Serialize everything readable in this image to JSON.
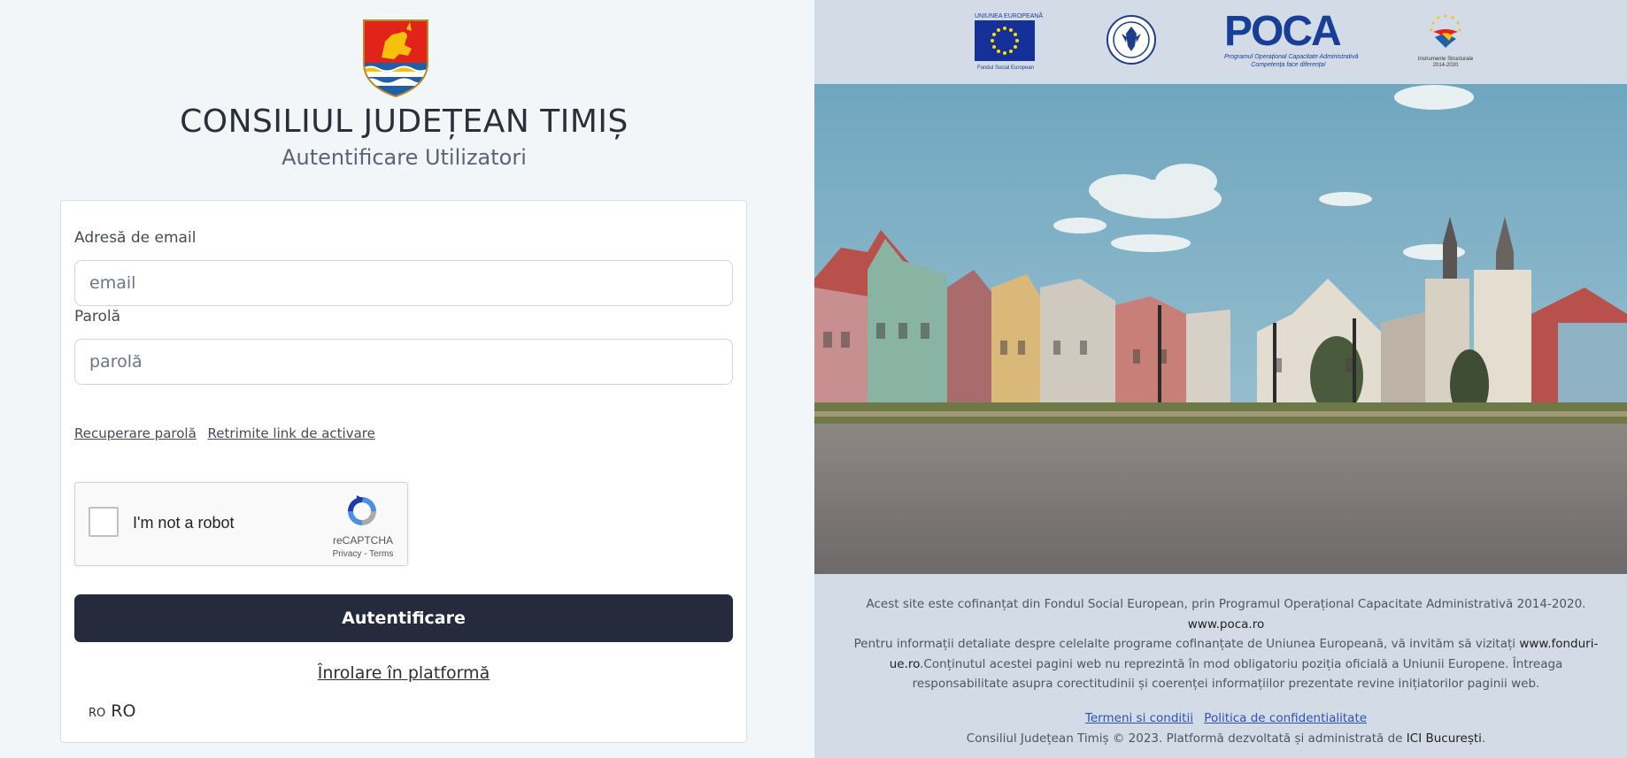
{
  "header": {
    "title": "CONSILIUL JUDEȚEAN TIMIȘ",
    "subtitle": "Autentificare Utilizatori"
  },
  "form": {
    "email_label": "Adresă de email",
    "email_placeholder": "email",
    "password_label": "Parolă",
    "password_placeholder": "parolă",
    "recover_link": "Recuperare parolă",
    "resend_link": "Retrimite link de activare",
    "submit_label": "Autentificare",
    "enroll_link": "Înrolare în platformă",
    "language_code": "RO",
    "language_label": "RO"
  },
  "captcha": {
    "label": "I'm not a robot",
    "brand": "reCAPTCHA",
    "privacy": "Privacy",
    "separator": " - ",
    "terms": "Terms",
    "checked": false
  },
  "logos": {
    "eu_top": "UNIUNEA EUROPEANĂ",
    "eu_bottom": "Fondul Social European",
    "gov_text": "GUVERNUL ROMÂNIEI",
    "poca_word": "POCA",
    "poca_line1": "Programul Operațional Capacitate Administrativă",
    "poca_line2": "Competența face diferența!",
    "instruments_line1": "Instrumente Structurale",
    "instruments_line2": "2014-2020"
  },
  "footer": {
    "line1": "Acest site este cofinanțat din Fondul Social European, prin Programul Operațional Capacitate Administrativă 2014-2020.",
    "poca_url": "www.poca.ro",
    "line2_prefix": "Pentru informații detaliate despre celelalte programe cofinanțate de Uniunea Europeană, vă invităm să vizitați ",
    "fonduri_url": "www.fonduri-ue.ro",
    "line2_suffix": ".Conținutul acestei pagini web nu reprezintă în mod obligatoriu poziția oficială a Uniunii Europene. Întreaga responsabilitate asupra corectitudinii și coerenței informațiilor prezentate revine inițiatorilor paginii web.",
    "terms_link": "Termeni si conditii",
    "privacy_link": "Politica de confidentialitate",
    "copyright_prefix": "Consiliul Județean Timiș © 2023. Platformă dezvoltată și administrată de ",
    "ici": "ICI București",
    "copyright_suffix": "."
  },
  "colors": {
    "page_bg": "#f3f6f9",
    "right_bg": "#d3dbe6",
    "button_bg": "#252a3c",
    "link_blue": "#2e51b3",
    "eu_blue": "#16309a",
    "eu_star": "#ffdd00"
  },
  "icons": [
    "coat-of-arms-icon",
    "recaptcha-logo-icon",
    "eu-flag-icon",
    "romanian-government-seal-icon",
    "poca-logo-icon",
    "structural-instruments-icon"
  ]
}
